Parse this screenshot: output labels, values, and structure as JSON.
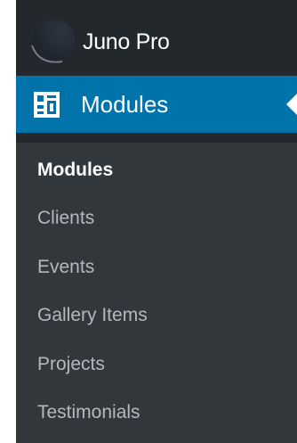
{
  "header": {
    "site_title": "Juno Pro",
    "icon": "site-logo-icon"
  },
  "menu": {
    "active_label": "Modules",
    "active_icon": "modules-icon",
    "submenu": [
      {
        "label": "Modules",
        "current": true
      },
      {
        "label": "Clients",
        "current": false
      },
      {
        "label": "Events",
        "current": false
      },
      {
        "label": "Gallery Items",
        "current": false
      },
      {
        "label": "Projects",
        "current": false
      },
      {
        "label": "Testimonials",
        "current": false
      }
    ]
  },
  "colors": {
    "sidebar_bg": "#23282d",
    "submenu_bg": "#32373c",
    "active_bg": "#0073aa",
    "text_white": "#ffffff",
    "text_muted": "#b4b9be"
  }
}
